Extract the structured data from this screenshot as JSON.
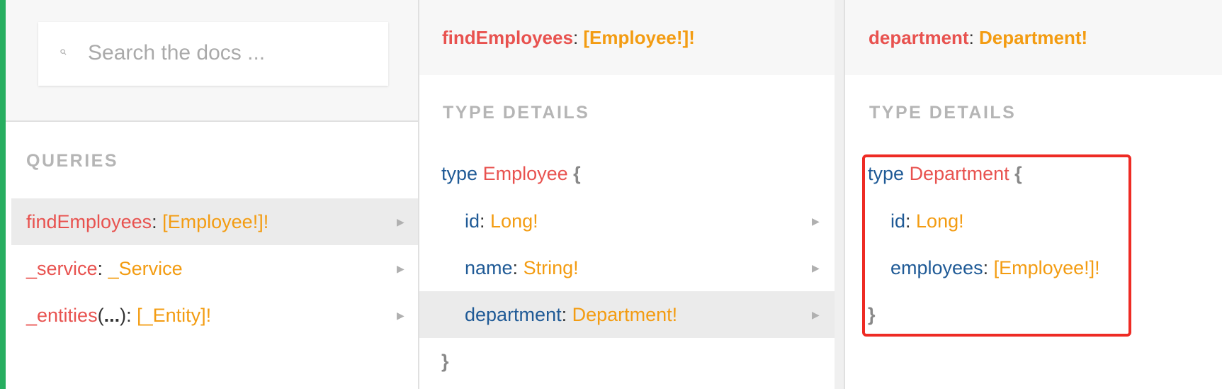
{
  "search": {
    "placeholder": "Search the docs ..."
  },
  "queries": {
    "title": "QUERIES",
    "items": [
      {
        "name": "findEmployees",
        "sep": ": ",
        "type": "[Employee!]!"
      },
      {
        "name": "_service",
        "sep": ": ",
        "type": "_Service"
      },
      {
        "name": "_entities",
        "args_open": "(",
        "args": "...",
        "args_close": "): ",
        "type": "[_Entity]!"
      }
    ]
  },
  "panel2": {
    "header": {
      "name": "findEmployees",
      "sep": ": ",
      "type": "[Employee!]!"
    },
    "type_details_title": "TYPE DETAILS",
    "keyword": "type",
    "type_name": "Employee",
    "open_brace": "{",
    "close_brace": "}",
    "fields": [
      {
        "name": "id",
        "sep": ": ",
        "type": "Long!"
      },
      {
        "name": "name",
        "sep": ": ",
        "type": "String!"
      },
      {
        "name": "department",
        "sep": ": ",
        "type": "Department!"
      }
    ]
  },
  "panel3": {
    "header": {
      "name": "department",
      "sep": ": ",
      "type": "Department!"
    },
    "type_details_title": "TYPE DETAILS",
    "keyword": "type",
    "type_name": "Department",
    "open_brace": "{",
    "close_brace": "}",
    "fields": [
      {
        "name": "id",
        "sep": ": ",
        "type": "Long!"
      },
      {
        "name": "employees",
        "sep": ": ",
        "type": "[Employee!]!"
      }
    ]
  },
  "icons": {
    "arrow": "▶",
    "search": "search-icon"
  },
  "colors": {
    "accent_green": "#27ae60",
    "field_red": "#e8524f",
    "type_orange": "#f39c12",
    "keyword_blue": "#1f5a96",
    "highlight_red": "#ee2b24"
  }
}
